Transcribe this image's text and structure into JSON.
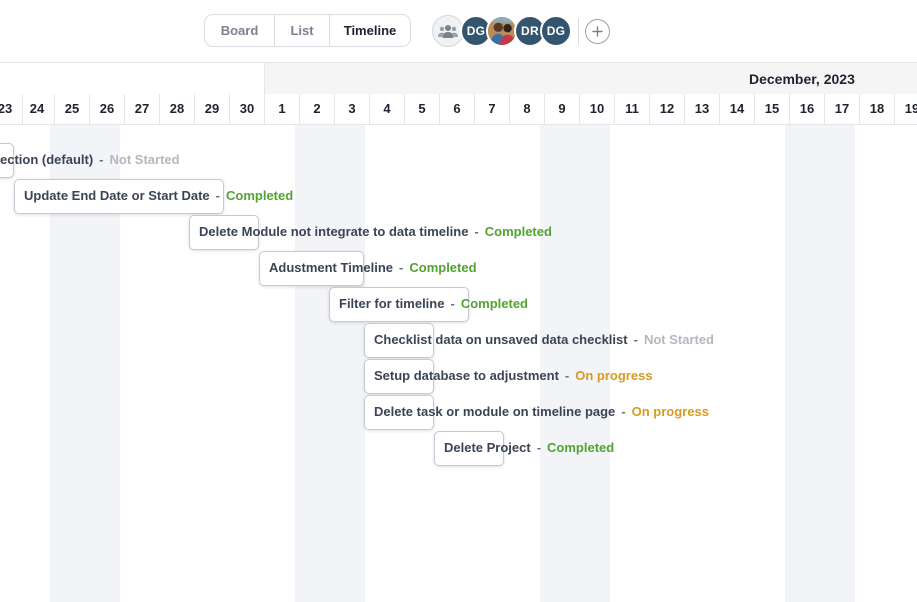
{
  "view_switch": {
    "tabs": [
      {
        "label": "Board",
        "active": false
      },
      {
        "label": "List",
        "active": false
      },
      {
        "label": "Timeline",
        "active": true
      }
    ]
  },
  "members": {
    "team_icon": "team-group-icon",
    "avatars": [
      {
        "type": "initials",
        "text": "DG",
        "color": "#35546e"
      },
      {
        "type": "photo",
        "text": "",
        "color": "#c7a06f"
      },
      {
        "type": "initials",
        "text": "DR",
        "color": "#35546e"
      },
      {
        "type": "initials",
        "text": "DG",
        "color": "#35546e"
      }
    ],
    "add_icon": "plus-icon"
  },
  "timeline": {
    "month": "December, 2023",
    "days": [
      "23",
      "24",
      "25",
      "26",
      "27",
      "28",
      "29",
      "30",
      "1",
      "2",
      "3",
      "4",
      "5",
      "6",
      "7",
      "8",
      "9",
      "10",
      "11",
      "12",
      "13",
      "14",
      "15",
      "16",
      "17",
      "18",
      "19"
    ],
    "tasks": [
      {
        "title": "ection (default)",
        "status": "Not Started",
        "status_class": "notstarted"
      },
      {
        "title": "Update End Date or Start Date",
        "status": "Completed",
        "status_class": "completed"
      },
      {
        "title": "Delete Module not integrate to data timeline",
        "status": "Completed",
        "status_class": "completed"
      },
      {
        "title": "Adustment Timeline",
        "status": "Completed",
        "status_class": "completed"
      },
      {
        "title": "Filter for timeline",
        "status": "Completed",
        "status_class": "completed"
      },
      {
        "title": "Checklist data on unsaved data checklist",
        "status": "Not Started",
        "status_class": "notstarted"
      },
      {
        "title": "Setup database to adjustment",
        "status": "On progress",
        "status_class": "progress"
      },
      {
        "title": "Delete task or module on timeline page",
        "status": "On progress",
        "status_class": "progress"
      },
      {
        "title": "Delete Project",
        "status": "Completed",
        "status_class": "completed"
      }
    ],
    "separator": "-"
  },
  "colors": {
    "completed": "#52a332",
    "not_started": "#b3b8c0",
    "on_progress": "#d79c1d",
    "avatar_bg": "#35546e",
    "weekend_band": "#f3f4f7"
  }
}
